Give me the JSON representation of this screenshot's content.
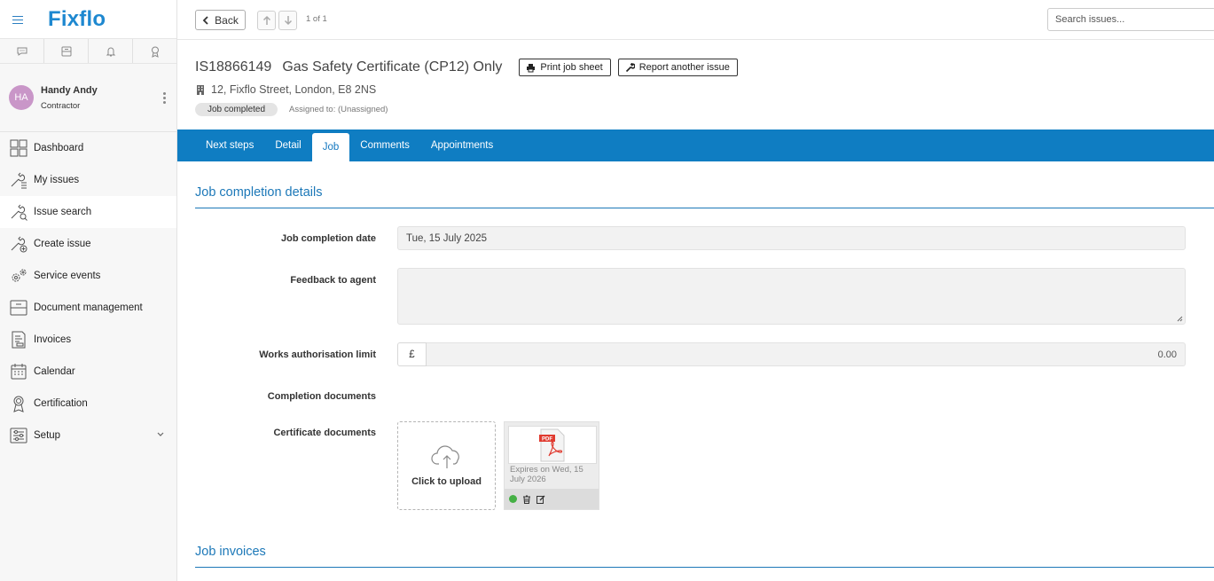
{
  "app": {
    "logo": "Fixflo"
  },
  "user": {
    "initials": "HA",
    "name": "Handy Andy",
    "role": "Contractor"
  },
  "sidebar": {
    "items": [
      {
        "label": "Dashboard",
        "icon": "dashboard-icon"
      },
      {
        "label": "My issues",
        "icon": "wrench-list-icon"
      },
      {
        "label": "Issue search",
        "icon": "wrench-search-icon",
        "active": true
      },
      {
        "label": "Create issue",
        "icon": "wrench-plus-icon"
      },
      {
        "label": "Service events",
        "icon": "gears-icon"
      },
      {
        "label": "Document management",
        "icon": "drawer-icon"
      },
      {
        "label": "Invoices",
        "icon": "invoice-icon"
      },
      {
        "label": "Calendar",
        "icon": "calendar-icon"
      },
      {
        "label": "Certification",
        "icon": "award-icon"
      },
      {
        "label": "Setup",
        "icon": "sliders-icon"
      }
    ]
  },
  "topbar": {
    "back_label": "Back",
    "pager": "1 of 1",
    "search_placeholder": "Search issues..."
  },
  "issue": {
    "id": "IS18866149",
    "title": "Gas Safety Certificate (CP12) Only",
    "print_label": "Print job sheet",
    "report_label": "Report another issue",
    "address": "12, Fixflo Street, London, E8 2NS",
    "status": "Job completed",
    "assigned": "Assigned to: (Unassigned)"
  },
  "tabs": [
    {
      "label": "Next steps"
    },
    {
      "label": "Detail"
    },
    {
      "label": "Job",
      "active": true
    },
    {
      "label": "Comments"
    },
    {
      "label": "Appointments"
    }
  ],
  "job": {
    "section_title": "Job completion details",
    "completion_date_label": "Job completion date",
    "completion_date_value": "Tue, 15 July 2025",
    "feedback_label": "Feedback to agent",
    "feedback_value": "",
    "limit_label": "Works authorisation limit",
    "currency": "£",
    "limit_value": "0.00",
    "completion_docs_label": "Completion documents",
    "certificate_docs_label": "Certificate documents",
    "upload_label": "Click to upload",
    "doc_badge": "PDF",
    "doc_expiry": "Expires on Wed, 15 July 2026",
    "invoices_title": "Job invoices"
  },
  "colors": {
    "accent": "#0f7dc2",
    "brand": "#1e88d0",
    "status_ok": "#45b045"
  }
}
